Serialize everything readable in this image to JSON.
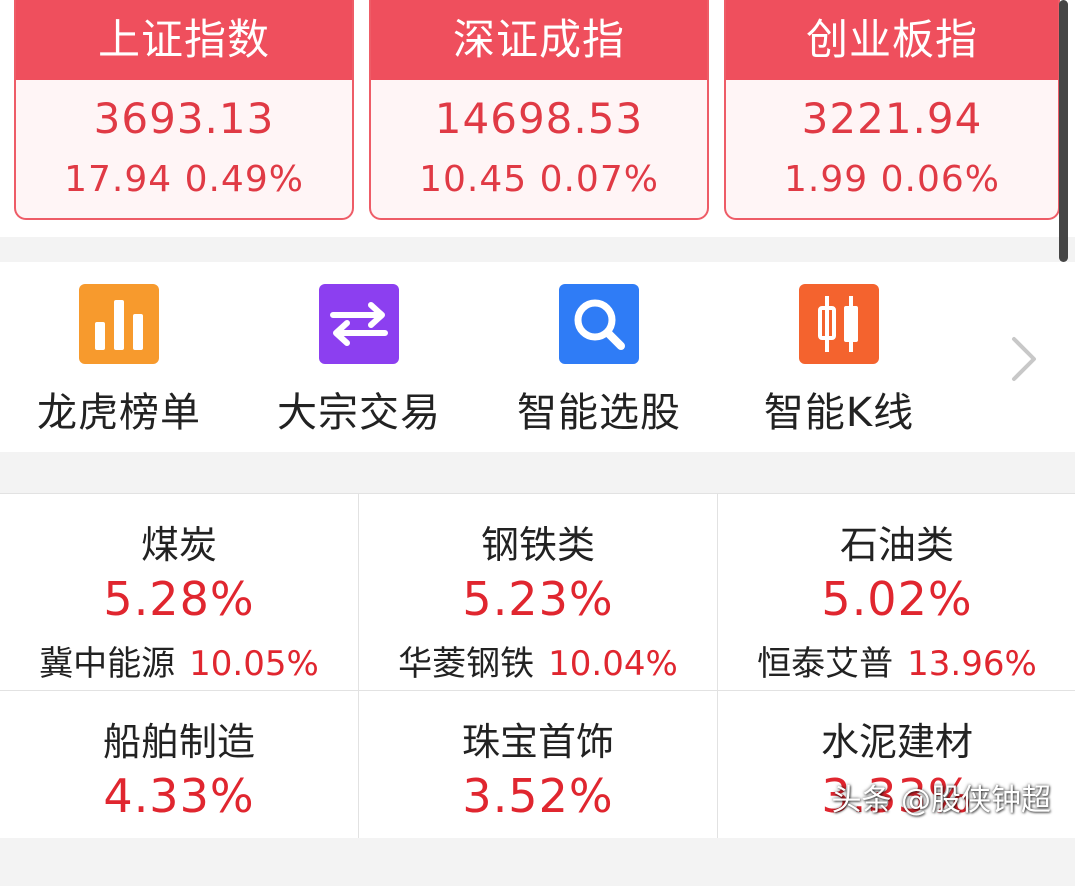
{
  "indices": [
    {
      "name": "上证指数",
      "value": "3693.13",
      "change": "17.94 0.49%"
    },
    {
      "name": "深证成指",
      "value": "14698.53",
      "change": "10.45 0.07%"
    },
    {
      "name": "创业板指",
      "value": "3221.94",
      "change": "1.99 0.06%"
    }
  ],
  "tools": [
    {
      "label": "龙虎榜单",
      "icon": "bar-chart-icon",
      "color": "#f79a2d"
    },
    {
      "label": "大宗交易",
      "icon": "swap-arrows-icon",
      "color": "#8c3ff0"
    },
    {
      "label": "智能选股",
      "icon": "search-icon",
      "color": "#2f7cf6"
    },
    {
      "label": "智能K线",
      "icon": "candlestick-icon",
      "color": "#f4632e"
    }
  ],
  "sectors": [
    {
      "name": "煤炭",
      "pct": "5.28%",
      "leader": "冀中能源",
      "leader_pct": "10.05%"
    },
    {
      "name": "钢铁类",
      "pct": "5.23%",
      "leader": "华菱钢铁",
      "leader_pct": "10.04%"
    },
    {
      "name": "石油类",
      "pct": "5.02%",
      "leader": "恒泰艾普",
      "leader_pct": "13.96%"
    },
    {
      "name": "船舶制造",
      "pct": "4.33%",
      "leader": "",
      "leader_pct": ""
    },
    {
      "name": "珠宝首饰",
      "pct": "3.52%",
      "leader": "",
      "leader_pct": ""
    },
    {
      "name": "水泥建材",
      "pct": "3.33%",
      "leader": "",
      "leader_pct": ""
    }
  ],
  "watermark": "头条 @股侠钟超",
  "colors": {
    "up": "#e0262f",
    "card_head": "#ef4f5d"
  }
}
